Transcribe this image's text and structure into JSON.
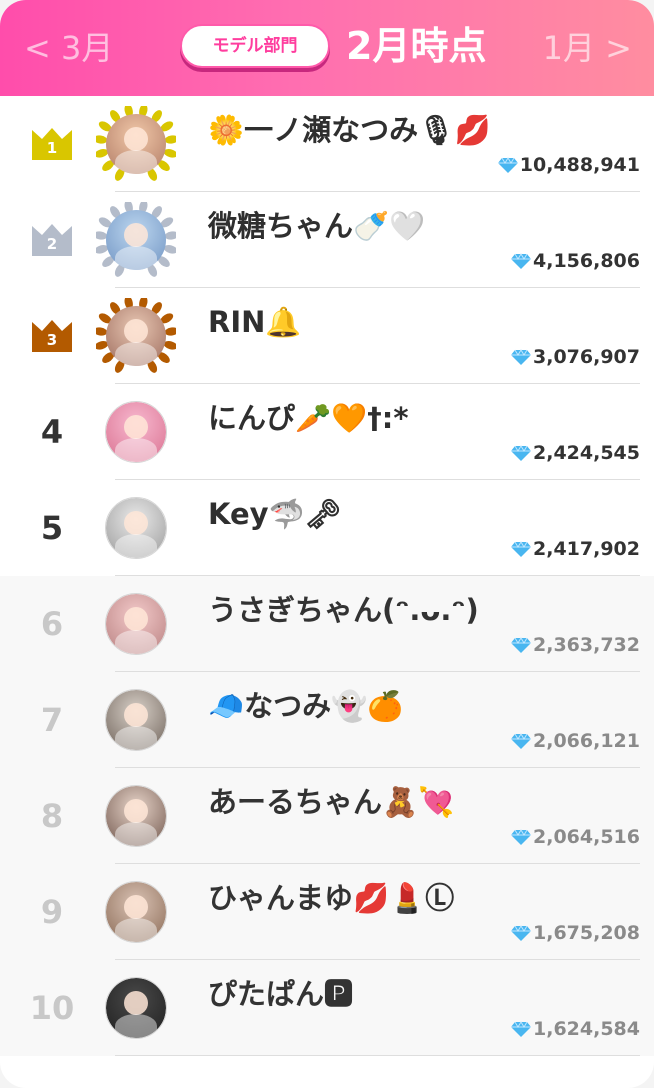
{
  "header": {
    "prev_label": "< 3月",
    "next_label": "1月 >",
    "category_label": "モデル部門",
    "period_label": "2月時点"
  },
  "colors": {
    "header_gradient_start": "#ff4dab",
    "header_gradient_end": "#ff8da0",
    "gold": "#d9c600",
    "silver": "#b4bcca",
    "bronze": "#b35a00",
    "diamond": "#49b6f0"
  },
  "icons": {
    "score": "diamond-icon",
    "top_rank": "crown-icon"
  },
  "rankings": [
    {
      "rank": "1",
      "name": "🌼一ノ瀬なつみ🎙💋",
      "score": "10,488,941",
      "crown": "gold"
    },
    {
      "rank": "2",
      "name": "微糖ちゃん🍼🤍",
      "score": "4,156,806",
      "crown": "silver"
    },
    {
      "rank": "3",
      "name": "RIN🔔",
      "score": "3,076,907",
      "crown": "bronze"
    },
    {
      "rank": "4",
      "name": "にんぴ🥕🧡†:*",
      "score": "2,424,545"
    },
    {
      "rank": "5",
      "name": "Key🦈🗝",
      "score": "2,417,902"
    },
    {
      "rank": "6",
      "name": "うさぎちゃん(ᵔ.ᴗ.ᵔ)",
      "score": "2,363,732"
    },
    {
      "rank": "7",
      "name": "🧢なつみ👻🍊",
      "score": "2,066,121"
    },
    {
      "rank": "8",
      "name": "あーるちゃん🧸💘",
      "score": "2,064,516"
    },
    {
      "rank": "9",
      "name": "ひゃんまゆ💋💄Ⓛ",
      "score": "1,675,208"
    },
    {
      "rank": "10",
      "name": "ぴたぱん🅿",
      "score": "1,624,584"
    }
  ]
}
